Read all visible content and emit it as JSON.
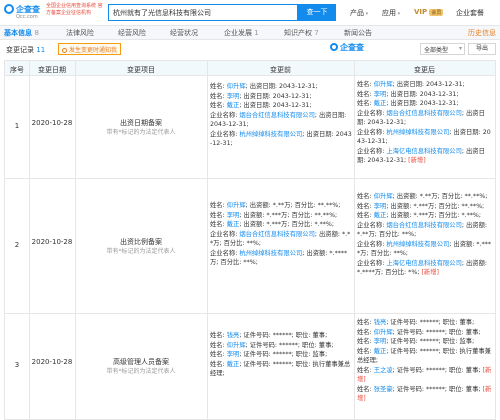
{
  "header": {
    "logo_text": "企查查",
    "logo_sub": "Qcc.com",
    "slogan": "全国企业信用查询系统 官方备案企业征信机构",
    "search_value": "杭州就有了光信息科技有限公司",
    "search_button": "查一下",
    "nav": [
      "产品",
      "应用",
      "VIP",
      "企业套餐"
    ],
    "vip_tag": "会员"
  },
  "tabs": {
    "items": [
      {
        "label": "基本信息",
        "count": "8"
      },
      {
        "label": "法律风险",
        "count": ""
      },
      {
        "label": "经营风险",
        "count": ""
      },
      {
        "label": "经营状况",
        "count": ""
      },
      {
        "label": "企业发展",
        "count": "1"
      },
      {
        "label": "知识产权",
        "count": "7"
      },
      {
        "label": "新闻公告",
        "count": ""
      }
    ],
    "history": "历史信息"
  },
  "section": {
    "title": "变更记录",
    "count": "11",
    "filter": "发生变更时通知我",
    "brand": "企查查",
    "select": "全部类型",
    "export": "导出"
  },
  "table": {
    "headers": [
      "序号",
      "变更日期",
      "变更项目",
      "变更前",
      "变更后"
    ],
    "rows": [
      {
        "seq": "1",
        "date": "2020-10-28",
        "item": "出资日期备案",
        "note": "带有*标记的为法定代表人",
        "before": [
          {
            "pre": "姓名: ",
            "link": "仰升辉",
            "post": "; 出资日期: 2043-12-31;"
          },
          {
            "pre": "姓名: ",
            "link": "李明",
            "post": "; 出资日期: 2043-12-31;"
          },
          {
            "pre": "姓名: ",
            "link": "戴正",
            "post": "; 出资日期: 2043-12-31;"
          },
          {
            "pre": "企业名称: ",
            "link": "烟台合红信息科技有限公司",
            "post": "; 出资日期: 2043-12-31;"
          },
          {
            "pre": "企业名称: ",
            "link": "杭州绰绰科技有限公司",
            "post": "; 出资日期: 2043-12-31;"
          }
        ],
        "after": [
          {
            "pre": "姓名: ",
            "link": "仰升辉",
            "post": "; 出资日期: 2043-12-31;"
          },
          {
            "pre": "姓名: ",
            "link": "李明",
            "post": "; 出资日期: 2043-12-31;"
          },
          {
            "pre": "姓名: ",
            "link": "戴正",
            "post": "; 出资日期: 2043-12-31;"
          },
          {
            "pre": "企业名称: ",
            "link": "烟台合红信息科技有限公司",
            "post": "; 出资日期: 2043-12-31;"
          },
          {
            "pre": "企业名称: ",
            "link": "杭州绰绰科技有限公司",
            "post": "; 出资日期: 2043-12-31;"
          },
          {
            "pre": "企业名称: ",
            "link": "上海亿电信息科技有限公司",
            "post": "; 出资日期: 2043-12-31; [新增]"
          }
        ]
      },
      {
        "seq": "2",
        "date": "2020-10-28",
        "item": "出资比例备案",
        "note": "带有*标记的为法定代表人",
        "before": [
          {
            "pre": "姓名: ",
            "link": "仰升辉",
            "post": "; 出资额: *.**万; 百分比: **.**%;"
          },
          {
            "pre": "姓名: ",
            "link": "李明",
            "post": "; 出资额: *.***万; 百分比: **.**%;"
          },
          {
            "pre": "姓名: ",
            "link": "戴正",
            "post": "; 出资额: *.***万; 百分比: *.**%;"
          },
          {
            "pre": "企业名称: ",
            "link": "烟台合红信息科技有限公司",
            "post": "; 出资额: *.**万; 百分比: **%;"
          },
          {
            "pre": "企业名称: ",
            "link": "杭州绰绰科技有限公司",
            "post": "; 出资额: *.****万; 百分比: **%;"
          }
        ],
        "after": [
          {
            "pre": "姓名: ",
            "link": "仰升辉",
            "post": "; 出资额: *.**万; 百分比: **.**%;"
          },
          {
            "pre": "姓名: ",
            "link": "李明",
            "post": "; 出资额: *.***万; 百分比: **.**%;"
          },
          {
            "pre": "姓名: ",
            "link": "戴正",
            "post": "; 出资额: *.***万; 百分比: *.**%;"
          },
          {
            "pre": "企业名称: ",
            "link": "烟台合红信息科技有限公司",
            "post": "; 出资额: *.**万; 百分比: **%;"
          },
          {
            "pre": "企业名称: ",
            "link": "杭州绰绰科技有限公司",
            "post": "; 出资额: *.****万; 百分比: **%;"
          },
          {
            "pre": "企业名称: ",
            "link": "上海亿电信息科技有限公司",
            "post": "; 出资额: *.****万; 百分比: *%; [新增]"
          }
        ]
      },
      {
        "seq": "3",
        "date": "2020-10-28",
        "item": "高级管理人员备案",
        "note": "带有*标记的为法定代表人",
        "before": [
          {
            "pre": "姓名: ",
            "link": "钱亮",
            "post": "; 证件号码: ******; 职位: 董事;"
          },
          {
            "pre": "姓名: ",
            "link": "仰升辉",
            "post": "; 证件号码: ******; 职位: 董事;"
          },
          {
            "pre": "姓名: ",
            "link": "李明",
            "post": "; 证件号码: ******; 职位: 监事;"
          },
          {
            "pre": "姓名: ",
            "link": "戴正",
            "post": "; 证件号码: ******; 职位: 执行董事兼总经理;"
          }
        ],
        "after": [
          {
            "pre": "姓名: ",
            "link": "钱亮",
            "post": "; 证件号码: ******; 职位: 董事;"
          },
          {
            "pre": "姓名: ",
            "link": "仰升辉",
            "post": "; 证件号码: ******; 职位: 董事;"
          },
          {
            "pre": "姓名: ",
            "link": "李明",
            "post": "; 证件号码: ******; 职位: 监事;"
          },
          {
            "pre": "姓名: ",
            "link": "戴正",
            "post": "; 证件号码: ******; 职位: 执行董事兼总经理;"
          },
          {
            "pre": "姓名: ",
            "link": "王之凌",
            "post": "; 证件号码: ******; 职位: 董事; [新增]"
          },
          {
            "pre": "姓名: ",
            "link": "张圣豪",
            "post": "; 证件号码: ******; 职位: 董事; [新增]"
          }
        ]
      }
    ]
  },
  "colors": {
    "accent": "#128bed",
    "new_tag": "#e74c3c",
    "header_bg": "#f2f9fc"
  }
}
